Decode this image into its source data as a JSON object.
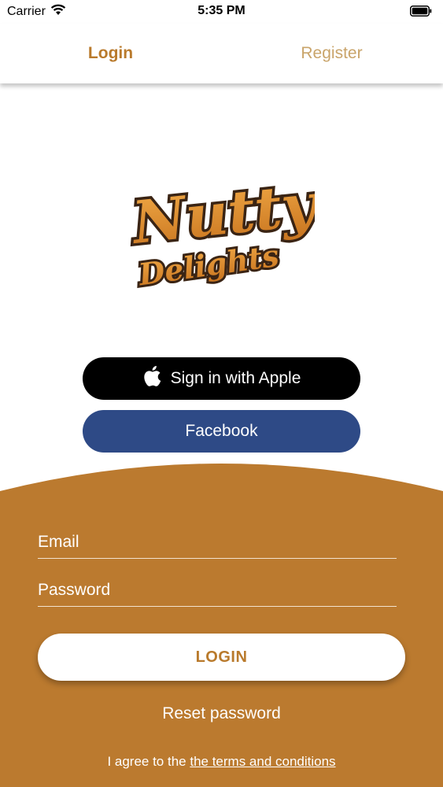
{
  "status_bar": {
    "carrier": "Carrier",
    "time": "5:35 PM",
    "icons": [
      "wifi-icon",
      "battery-icon"
    ]
  },
  "tabs": [
    {
      "label": "Login",
      "active": true
    },
    {
      "label": "Register",
      "active": false
    }
  ],
  "logo": {
    "line1": "Nutty",
    "line2": "Delights"
  },
  "social": {
    "apple_label": "Sign in with Apple",
    "apple_icon": "apple-icon",
    "facebook_label": "Facebook"
  },
  "form": {
    "email_placeholder": "Email",
    "password_placeholder": "Password",
    "login_label": "LOGIN",
    "reset_label": "Reset password",
    "terms_prefix": "I agree to the ",
    "terms_link": "the terms and conditions"
  },
  "colors": {
    "brand": "#bb7a2f",
    "facebook": "#2e4a86",
    "apple": "#000000",
    "tab_active": "#b97a2c",
    "tab_inactive": "#c9a46a"
  }
}
